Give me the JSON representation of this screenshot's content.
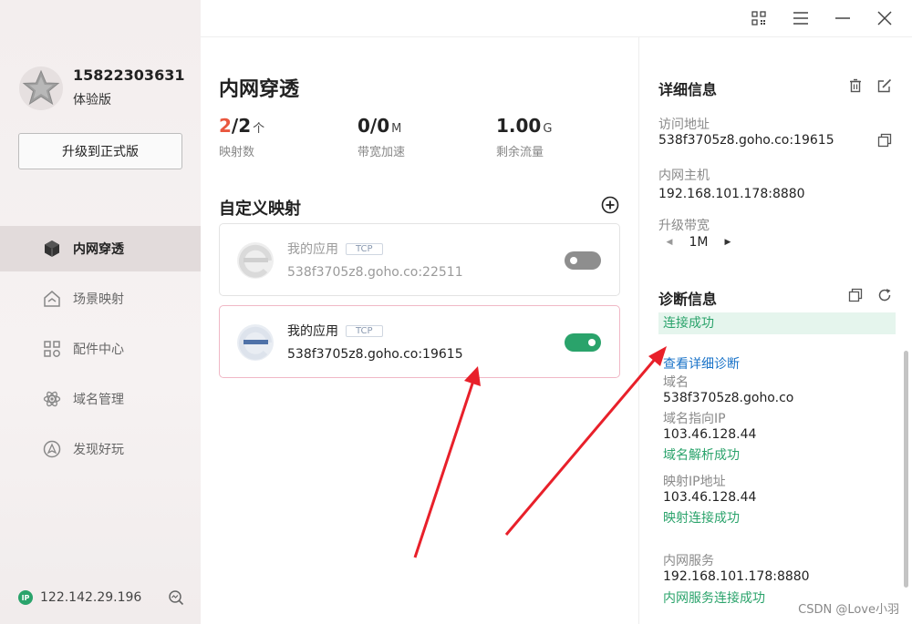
{
  "account": {
    "phone": "15822303631",
    "plan": "体验版",
    "upgrade_label": "升级到正式版"
  },
  "nav": {
    "items": [
      {
        "label": "内网穿透",
        "icon": "cube-icon",
        "active": true
      },
      {
        "label": "场景映射",
        "icon": "house-icon",
        "active": false
      },
      {
        "label": "配件中心",
        "icon": "grid-icon",
        "active": false
      },
      {
        "label": "域名管理",
        "icon": "atom-icon",
        "active": false
      },
      {
        "label": "发现好玩",
        "icon": "compass-icon",
        "active": false
      }
    ]
  },
  "footer": {
    "ip_badge": "IP",
    "ip": "122.142.29.196"
  },
  "main": {
    "title": "内网穿透",
    "stats": [
      {
        "highlight": "2",
        "value": "/2",
        "unit": "个",
        "label": "映射数"
      },
      {
        "highlight": "",
        "value": "0/0",
        "unit": "M",
        "label": "带宽加速"
      },
      {
        "highlight": "",
        "value": "1.00",
        "unit": "G",
        "label": "剩余流量"
      }
    ],
    "section_title": "自定义映射",
    "mappings": [
      {
        "name": "我的应用",
        "protocol": "TCP",
        "address": "538f3705z8.goho.co:22511",
        "enabled": false
      },
      {
        "name": "我的应用",
        "protocol": "TCP",
        "address": "538f3705z8.goho.co:19615",
        "enabled": true
      }
    ]
  },
  "details": {
    "title": "详细信息",
    "access_label": "访问地址",
    "access_value": "538f3705z8.goho.co:19615",
    "host_label": "内网主机",
    "host_value": "192.168.101.178:8880",
    "bandwidth_label": "升级带宽",
    "bandwidth_value": "1M"
  },
  "diagnostics": {
    "title": "诊断信息",
    "status": "连接成功",
    "detail_link": "查看详细诊断",
    "domain_label": "域名",
    "domain_value": "538f3705z8.goho.co",
    "domain_ip_label": "域名指向IP",
    "domain_ip_value": "103.46.128.44",
    "domain_resolve_ok": "域名解析成功",
    "mapped_ip_label": "映射IP地址",
    "mapped_ip_value": "103.46.128.44",
    "mapped_connect_ok": "映射连接成功",
    "service_label": "内网服务",
    "service_value": "192.168.101.178:8880",
    "service_connect_ok": "内网服务连接成功"
  },
  "watermark": "CSDN @Love小羽",
  "colors": {
    "accent_green": "#2aa36b",
    "highlight_red": "#e9573f",
    "link_blue": "#1a73c8",
    "arrow_red": "#e8202a"
  }
}
